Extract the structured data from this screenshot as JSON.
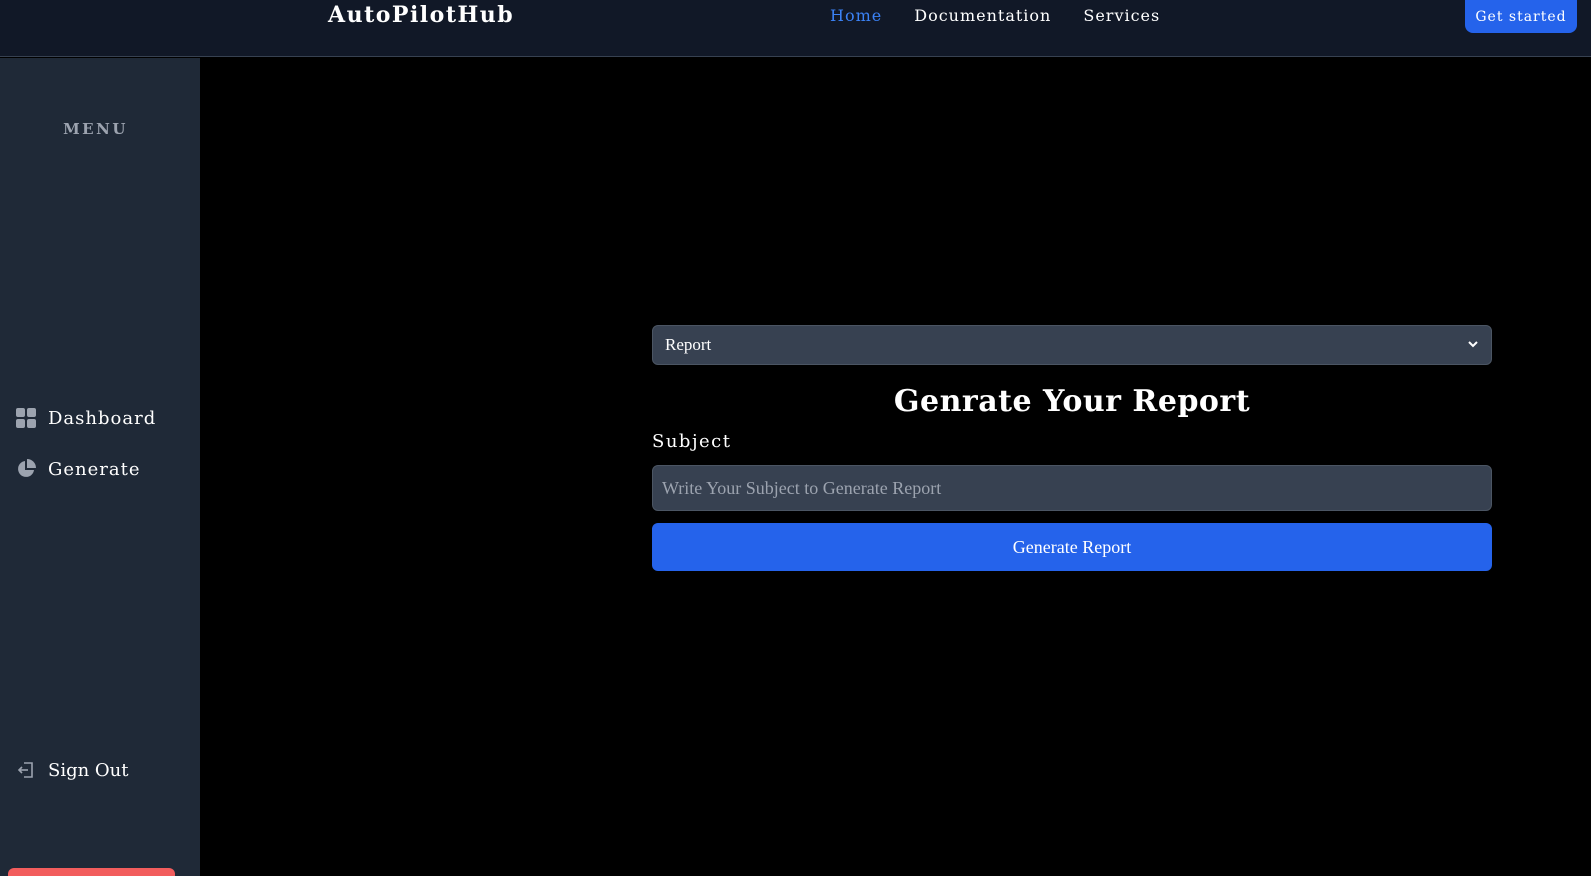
{
  "header": {
    "brand": "AutoPilotHub",
    "nav": [
      "Home",
      "Documentation",
      "Services"
    ],
    "active_nav": "Home",
    "cta_label": "Get started"
  },
  "sidebar": {
    "menu_title": "MENU",
    "items": [
      {
        "label": "Dashboard",
        "icon": "grid-icon"
      },
      {
        "label": "Generate",
        "icon": "pie-chart-icon"
      }
    ],
    "sign_out_label": "Sign Out",
    "sign_out_icon": "logout-icon"
  },
  "form": {
    "select_value": "Report",
    "heading": "Genrate Your Report",
    "subject_label": "Subject",
    "subject_placeholder": "Write Your Subject to Generate Report",
    "submit_label": "Generate Report"
  },
  "colors": {
    "accent": "#2563eb",
    "active_link": "#3b82f6",
    "sidebar_bg": "#1f2937",
    "topbar_bg": "#111827",
    "danger": "#f25d5d"
  }
}
